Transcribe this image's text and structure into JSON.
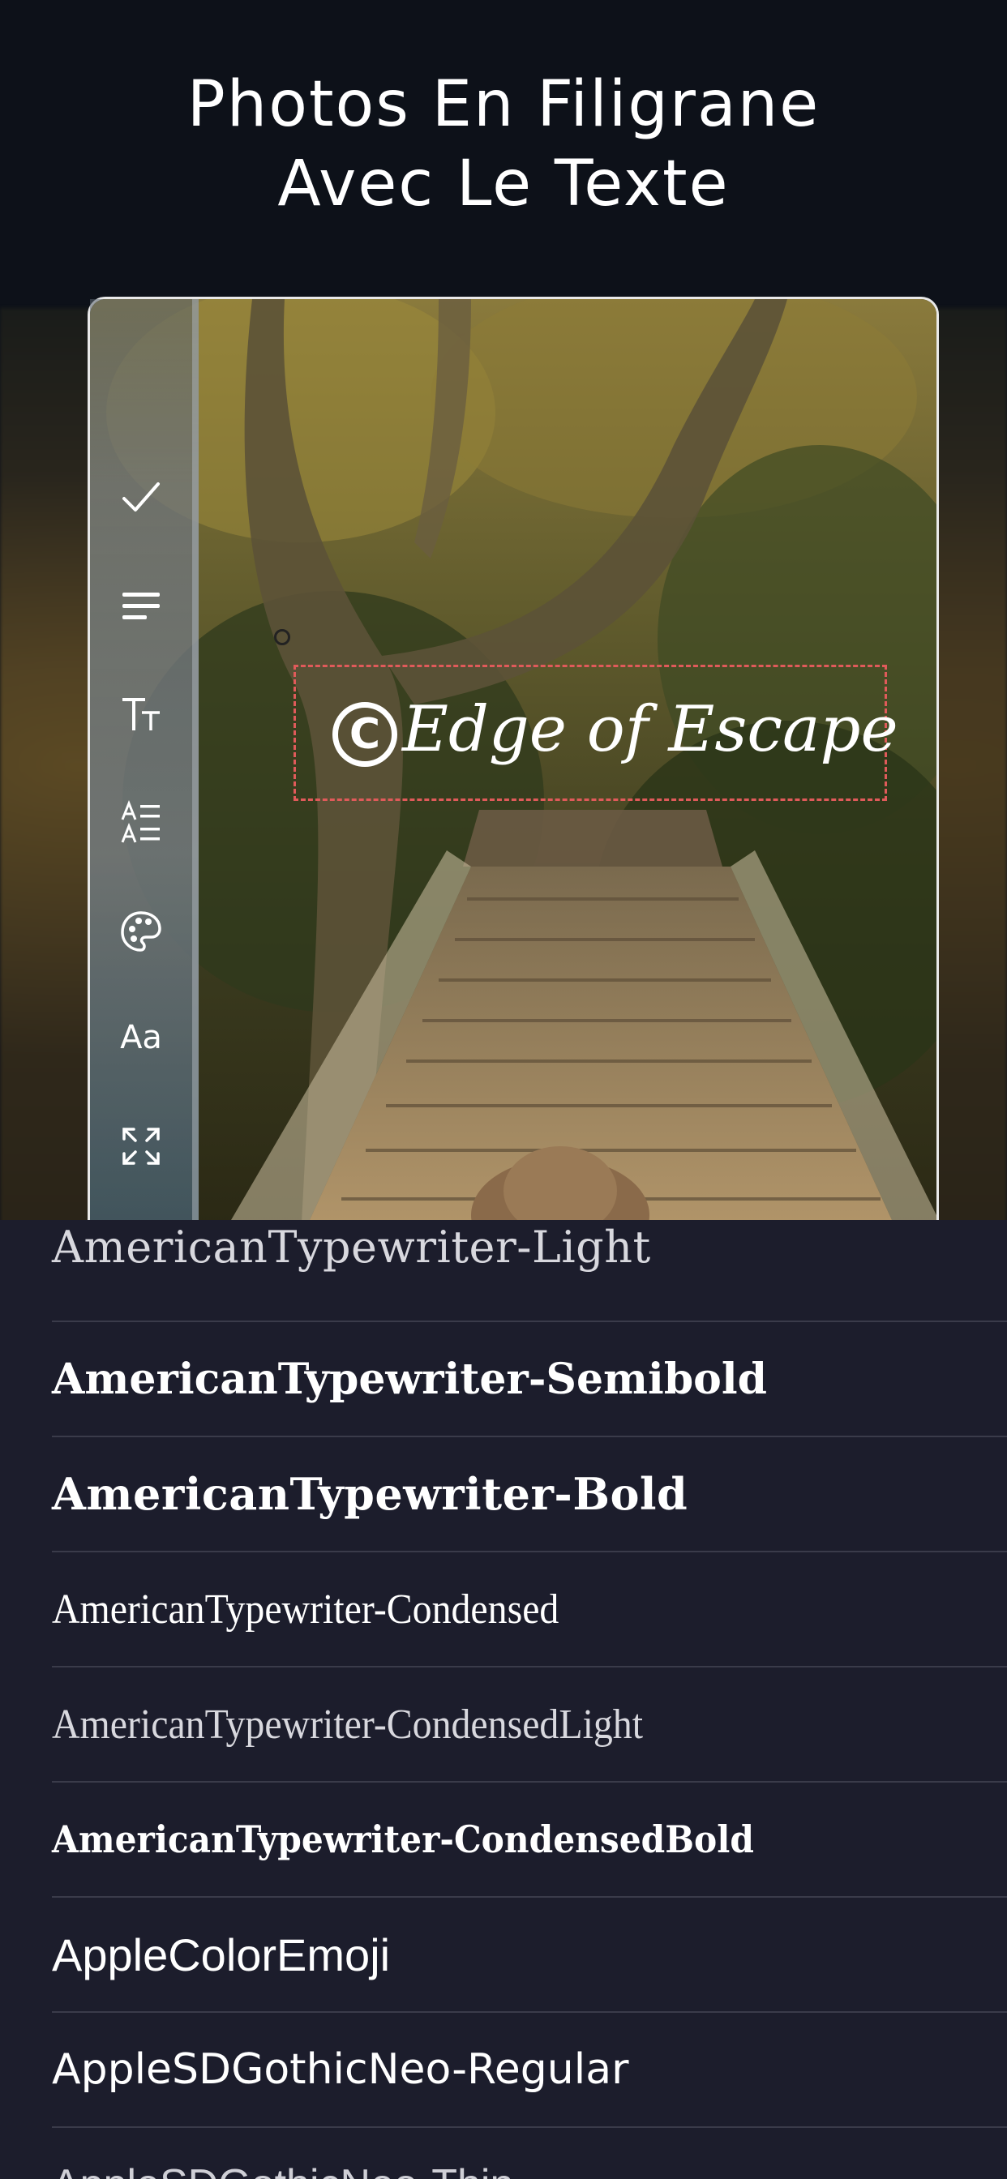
{
  "header": {
    "line1": "Photos En Filigrane",
    "line2": "Avec Le Texte"
  },
  "toolbar": {
    "items": [
      {
        "icon": "checkmark-icon"
      },
      {
        "icon": "align-left-icon"
      },
      {
        "icon": "text-size-icon"
      },
      {
        "icon": "line-spacing-icon"
      },
      {
        "icon": "palette-icon"
      },
      {
        "icon": "font-icon",
        "label": "Aa"
      },
      {
        "icon": "expand-icon"
      }
    ]
  },
  "watermark": {
    "symbol": "C",
    "text": "Edge of Escape",
    "box_color": "#e05a5a"
  },
  "fonts": [
    "AmericanTypewriter-Light",
    "AmericanTypewriter-Semibold",
    "AmericanTypewriter-Bold",
    "AmericanTypewriter-Condensed",
    "AmericanTypewriter-CondensedLight",
    "AmericanTypewriter-CondensedBold",
    "AppleColorEmoji",
    "AppleSDGothicNeo-Regular",
    "AppleSDGothicNeo-Thin"
  ],
  "colors": {
    "background": "#0d1119",
    "list_background": "#1c1d2c",
    "divider": "#3a3b4a",
    "text": "#ffffff"
  }
}
